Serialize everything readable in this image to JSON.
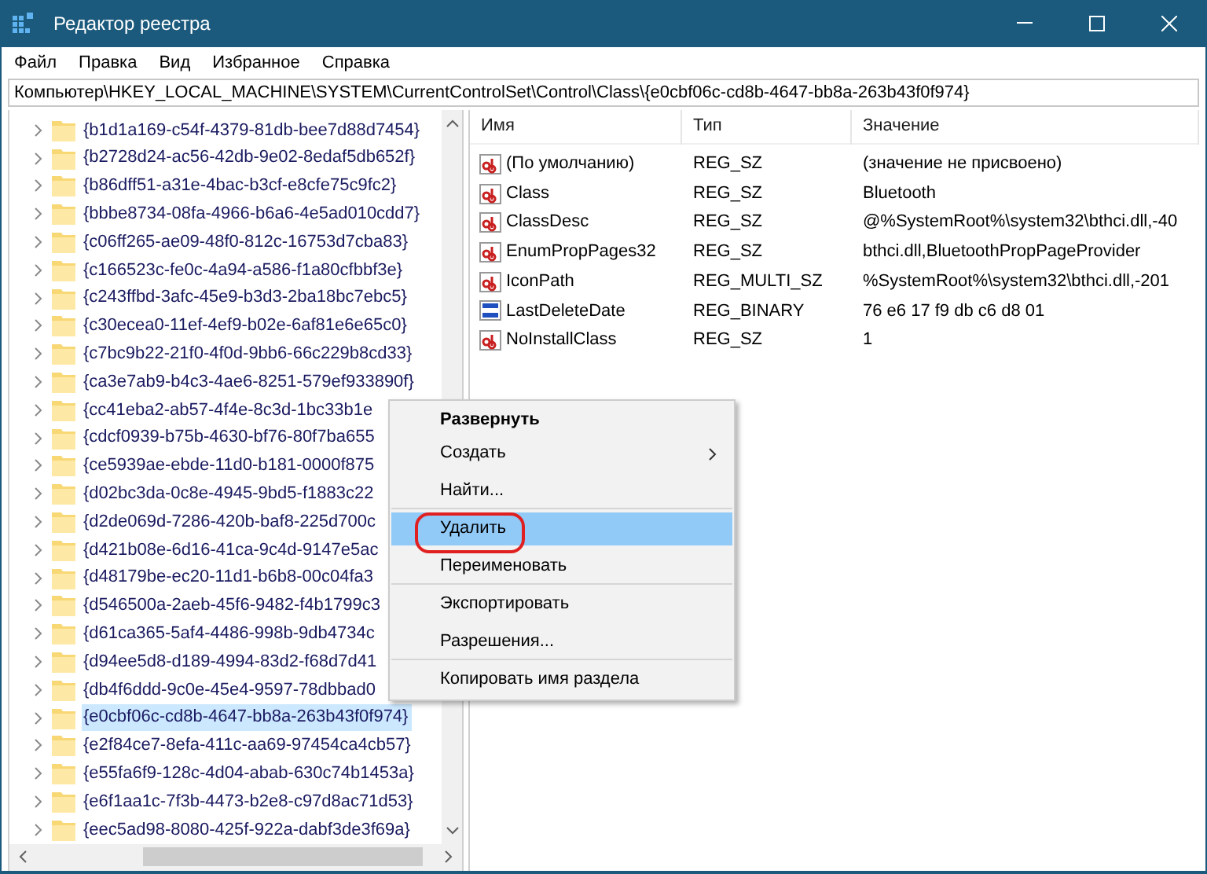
{
  "window": {
    "title": "Редактор реестра"
  },
  "menu": [
    "Файл",
    "Правка",
    "Вид",
    "Избранное",
    "Справка"
  ],
  "address": "Компьютер\\HKEY_LOCAL_MACHINE\\SYSTEM\\CurrentControlSet\\Control\\Class\\{e0cbf06c-cd8b-4647-bb8a-263b43f0f974}",
  "tree": [
    {
      "label": "{b1d1a169-c54f-4379-81db-bee7d88d7454}",
      "selected": false
    },
    {
      "label": "{b2728d24-ac56-42db-9e02-8edaf5db652f}",
      "selected": false
    },
    {
      "label": "{b86dff51-a31e-4bac-b3cf-e8cfe75c9fc2}",
      "selected": false
    },
    {
      "label": "{bbbe8734-08fa-4966-b6a6-4e5ad010cdd7}",
      "selected": false
    },
    {
      "label": "{c06ff265-ae09-48f0-812c-16753d7cba83}",
      "selected": false
    },
    {
      "label": "{c166523c-fe0c-4a94-a586-f1a80cfbbf3e}",
      "selected": false
    },
    {
      "label": "{c243ffbd-3afc-45e9-b3d3-2ba18bc7ebc5}",
      "selected": false
    },
    {
      "label": "{c30ecea0-11ef-4ef9-b02e-6af81e6e65c0}",
      "selected": false
    },
    {
      "label": "{c7bc9b22-21f0-4f0d-9bb6-66c229b8cd33}",
      "selected": false
    },
    {
      "label": "{ca3e7ab9-b4c3-4ae6-8251-579ef933890f}",
      "selected": false
    },
    {
      "label": "{cc41eba2-ab57-4f4e-8c3d-1bc33b1e",
      "selected": false
    },
    {
      "label": "{cdcf0939-b75b-4630-bf76-80f7ba655",
      "selected": false
    },
    {
      "label": "{ce5939ae-ebde-11d0-b181-0000f875",
      "selected": false
    },
    {
      "label": "{d02bc3da-0c8e-4945-9bd5-f1883c22",
      "selected": false
    },
    {
      "label": "{d2de069d-7286-420b-baf8-225d700c",
      "selected": false
    },
    {
      "label": "{d421b08e-6d16-41ca-9c4d-9147e5ac",
      "selected": false
    },
    {
      "label": "{d48179be-ec20-11d1-b6b8-00c04fa3",
      "selected": false
    },
    {
      "label": "{d546500a-2aeb-45f6-9482-f4b1799c3",
      "selected": false
    },
    {
      "label": "{d61ca365-5af4-4486-998b-9db4734c",
      "selected": false
    },
    {
      "label": "{d94ee5d8-d189-4994-83d2-f68d7d41",
      "selected": false
    },
    {
      "label": "{db4f6ddd-9c0e-45e4-9597-78dbbad0",
      "selected": false
    },
    {
      "label": "{e0cbf06c-cd8b-4647-bb8a-263b43f0f974}",
      "selected": true
    },
    {
      "label": "{e2f84ce7-8efa-411c-aa69-97454ca4cb57}",
      "selected": false
    },
    {
      "label": "{e55fa6f9-128c-4d04-abab-630c74b1453a}",
      "selected": false
    },
    {
      "label": "{e6f1aa1c-7f3b-4473-b2e8-c97d8ac71d53}",
      "selected": false
    },
    {
      "label": "{eec5ad98-8080-425f-922a-dabf3de3f69a}",
      "selected": false
    }
  ],
  "values": {
    "columns": [
      "Имя",
      "Тип",
      "Значение"
    ],
    "rows": [
      {
        "kind": "string",
        "name": "(По умолчанию)",
        "type": "REG_SZ",
        "data": "(значение не присвоено)"
      },
      {
        "kind": "string",
        "name": "Class",
        "type": "REG_SZ",
        "data": "Bluetooth"
      },
      {
        "kind": "string",
        "name": "ClassDesc",
        "type": "REG_SZ",
        "data": "@%SystemRoot%\\system32\\bthci.dll,-40"
      },
      {
        "kind": "string",
        "name": "EnumPropPages32",
        "type": "REG_SZ",
        "data": "bthci.dll,BluetoothPropPageProvider"
      },
      {
        "kind": "string",
        "name": "IconPath",
        "type": "REG_MULTI_SZ",
        "data": "%SystemRoot%\\system32\\bthci.dll,-201"
      },
      {
        "kind": "binary",
        "name": "LastDeleteDate",
        "type": "REG_BINARY",
        "data": "76 e6 17 f9 db c6 d8 01"
      },
      {
        "kind": "string",
        "name": "NoInstallClass",
        "type": "REG_SZ",
        "data": "1"
      }
    ]
  },
  "context_menu": [
    {
      "label": "Развернуть",
      "kind": "default",
      "selected": false,
      "submenu": false,
      "separator_after": false
    },
    {
      "label": "Создать",
      "kind": "item",
      "selected": false,
      "submenu": true,
      "separator_after": false
    },
    {
      "label": "Найти...",
      "kind": "item",
      "selected": false,
      "submenu": false,
      "separator_after": true
    },
    {
      "label": "Удалить",
      "kind": "item",
      "selected": true,
      "submenu": false,
      "separator_after": false
    },
    {
      "label": "Переименовать",
      "kind": "item",
      "selected": false,
      "submenu": false,
      "separator_after": true
    },
    {
      "label": "Экспортировать",
      "kind": "item",
      "selected": false,
      "submenu": false,
      "separator_after": false
    },
    {
      "label": "Разрешения...",
      "kind": "item",
      "selected": false,
      "submenu": false,
      "separator_after": true
    },
    {
      "label": "Копировать имя раздела",
      "kind": "item",
      "selected": false,
      "submenu": false,
      "separator_after": false
    }
  ]
}
